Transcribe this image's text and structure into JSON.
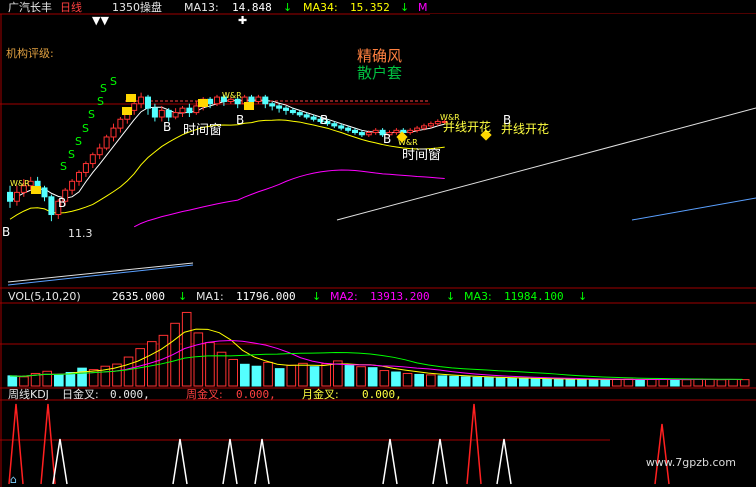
{
  "header": {
    "stock_name": "广汽长丰",
    "period": "日线",
    "indicator": "1350操盘",
    "ma13_label": "MA13:",
    "ma13_value": "14.848",
    "ma34_label": "MA34:",
    "ma34_value": "15.352",
    "arrow": "↓",
    "cut_mark": "M"
  },
  "price_panel": {
    "rating_label": "机构评级:",
    "overlay_line1": "精确风",
    "overlay_line2": "散户套",
    "low_label": "11.3",
    "time_window_label": "时间窗",
    "merge_label": "并线开花",
    "buy_mark": "B",
    "sell_mark": "S",
    "war_mark": "W&R"
  },
  "vol_header": {
    "name": "VOL(5,10,20)",
    "value": "2635.000",
    "ma1_label": "MA1:",
    "ma1_value": "11796.000",
    "ma2_label": "MA2:",
    "ma2_value": "13913.200",
    "ma3_label": "MA3:",
    "ma3_value": "11984.100",
    "arrow": "↓"
  },
  "kdj_header": {
    "name": "周线KDJ",
    "daily_label": "日金叉:",
    "daily_value": "0.000,",
    "weekly_label": "周金叉:",
    "weekly_value": "0.000,",
    "monthly_label": "月金叉:",
    "monthly_value": "0.000,"
  },
  "watermark": "www.7gpzb.com",
  "colors": {
    "up": "#ff3232",
    "down": "#54ffff",
    "ma_white": "#ffffff",
    "ma_yellow": "#ffff00",
    "ma_magenta": "#ff00ff",
    "ma_blue": "#5aa0ff",
    "grid": "#a00000"
  },
  "chart_data": [
    {
      "type": "candlestick",
      "series": [
        {
          "name": "MA13",
          "value": 14.848
        },
        {
          "name": "MA34",
          "value": 15.352
        }
      ],
      "low_annotation": 11.3,
      "candles": [
        {
          "o": 12.6,
          "c": 12.2,
          "h": 12.9,
          "l": 11.9
        },
        {
          "o": 12.2,
          "c": 12.6,
          "h": 12.9,
          "l": 12.0
        },
        {
          "o": 12.6,
          "c": 12.9,
          "h": 13.2,
          "l": 12.4
        },
        {
          "o": 12.9,
          "c": 13.1,
          "h": 13.3,
          "l": 12.7
        },
        {
          "o": 13.1,
          "c": 12.8,
          "h": 13.3,
          "l": 12.6
        },
        {
          "o": 12.8,
          "c": 12.4,
          "h": 12.9,
          "l": 12.2
        },
        {
          "o": 12.4,
          "c": 11.6,
          "h": 12.5,
          "l": 11.3
        },
        {
          "o": 11.6,
          "c": 12.2,
          "h": 12.3,
          "l": 11.4
        },
        {
          "o": 12.2,
          "c": 12.7,
          "h": 12.8,
          "l": 12.0
        },
        {
          "o": 12.7,
          "c": 13.1,
          "h": 13.2,
          "l": 12.5
        },
        {
          "o": 13.1,
          "c": 13.5,
          "h": 13.6,
          "l": 12.9
        },
        {
          "o": 13.5,
          "c": 13.9,
          "h": 14.0,
          "l": 13.3
        },
        {
          "o": 13.9,
          "c": 14.3,
          "h": 14.4,
          "l": 13.7
        },
        {
          "o": 14.3,
          "c": 14.6,
          "h": 14.8,
          "l": 14.1
        },
        {
          "o": 14.6,
          "c": 15.1,
          "h": 15.2,
          "l": 14.5
        },
        {
          "o": 15.1,
          "c": 15.5,
          "h": 15.7,
          "l": 14.9
        },
        {
          "o": 15.5,
          "c": 15.9,
          "h": 16.0,
          "l": 15.3
        },
        {
          "o": 15.9,
          "c": 16.3,
          "h": 16.4,
          "l": 15.7
        },
        {
          "o": 16.3,
          "c": 16.6,
          "h": 16.8,
          "l": 16.1
        },
        {
          "o": 16.6,
          "c": 16.9,
          "h": 17.1,
          "l": 16.4
        },
        {
          "o": 16.9,
          "c": 16.4,
          "h": 17.0,
          "l": 16.1
        },
        {
          "o": 16.4,
          "c": 16.0,
          "h": 16.6,
          "l": 15.8
        },
        {
          "o": 16.0,
          "c": 16.3,
          "h": 16.5,
          "l": 15.8
        },
        {
          "o": 16.3,
          "c": 16.0,
          "h": 16.4,
          "l": 15.8
        },
        {
          "o": 16.0,
          "c": 16.2,
          "h": 16.4,
          "l": 15.9
        },
        {
          "o": 16.2,
          "c": 16.4,
          "h": 16.5,
          "l": 16.0
        },
        {
          "o": 16.4,
          "c": 16.2,
          "h": 16.6,
          "l": 16.0
        },
        {
          "o": 16.2,
          "c": 16.5,
          "h": 16.7,
          "l": 16.1
        },
        {
          "o": 16.5,
          "c": 16.8,
          "h": 16.9,
          "l": 16.3
        },
        {
          "o": 16.8,
          "c": 16.6,
          "h": 16.9,
          "l": 16.4
        },
        {
          "o": 16.6,
          "c": 16.9,
          "h": 17.0,
          "l": 16.5
        },
        {
          "o": 16.9,
          "c": 16.7,
          "h": 17.0,
          "l": 16.5
        },
        {
          "o": 16.7,
          "c": 16.8,
          "h": 16.9,
          "l": 16.6
        },
        {
          "o": 16.8,
          "c": 16.6,
          "h": 16.9,
          "l": 16.4
        },
        {
          "o": 16.6,
          "c": 16.9,
          "h": 17.0,
          "l": 16.5
        },
        {
          "o": 16.9,
          "c": 16.7,
          "h": 17.0,
          "l": 16.6
        },
        {
          "o": 16.7,
          "c": 16.9,
          "h": 17.0,
          "l": 16.6
        },
        {
          "o": 16.9,
          "c": 16.6,
          "h": 17.0,
          "l": 16.4
        },
        {
          "o": 16.6,
          "c": 16.5,
          "h": 16.7,
          "l": 16.3
        },
        {
          "o": 16.5,
          "c": 16.4,
          "h": 16.6,
          "l": 16.2
        },
        {
          "o": 16.4,
          "c": 16.3,
          "h": 16.5,
          "l": 16.1
        },
        {
          "o": 16.3,
          "c": 16.2,
          "h": 16.4,
          "l": 16.1
        },
        {
          "o": 16.2,
          "c": 16.1,
          "h": 16.3,
          "l": 16.0
        },
        {
          "o": 16.1,
          "c": 16.0,
          "h": 16.2,
          "l": 15.9
        },
        {
          "o": 16.0,
          "c": 15.9,
          "h": 16.1,
          "l": 15.8
        },
        {
          "o": 15.9,
          "c": 15.8,
          "h": 16.0,
          "l": 15.7
        },
        {
          "o": 15.8,
          "c": 15.7,
          "h": 15.9,
          "l": 15.6
        },
        {
          "o": 15.7,
          "c": 15.6,
          "h": 15.8,
          "l": 15.5
        },
        {
          "o": 15.6,
          "c": 15.5,
          "h": 15.7,
          "l": 15.4
        },
        {
          "o": 15.5,
          "c": 15.4,
          "h": 15.6,
          "l": 15.3
        },
        {
          "o": 15.4,
          "c": 15.3,
          "h": 15.5,
          "l": 15.2
        },
        {
          "o": 15.3,
          "c": 15.2,
          "h": 15.4,
          "l": 15.1
        },
        {
          "o": 15.2,
          "c": 15.3,
          "h": 15.4,
          "l": 15.1
        },
        {
          "o": 15.3,
          "c": 15.4,
          "h": 15.5,
          "l": 15.2
        },
        {
          "o": 15.4,
          "c": 15.2,
          "h": 15.5,
          "l": 15.1
        },
        {
          "o": 15.2,
          "c": 15.3,
          "h": 15.4,
          "l": 15.1
        },
        {
          "o": 15.3,
          "c": 15.4,
          "h": 15.5,
          "l": 15.2
        },
        {
          "o": 15.4,
          "c": 15.3,
          "h": 15.5,
          "l": 15.2
        },
        {
          "o": 15.3,
          "c": 15.4,
          "h": 15.5,
          "l": 15.2
        },
        {
          "o": 15.4,
          "c": 15.5,
          "h": 15.6,
          "l": 15.3
        },
        {
          "o": 15.5,
          "c": 15.6,
          "h": 15.7,
          "l": 15.4
        },
        {
          "o": 15.6,
          "c": 15.7,
          "h": 15.8,
          "l": 15.5
        },
        {
          "o": 15.7,
          "c": 15.8,
          "h": 15.9,
          "l": 15.6
        },
        {
          "o": 15.8,
          "c": 15.8,
          "h": 15.9,
          "l": 15.7
        }
      ]
    },
    {
      "type": "bar",
      "series": [
        {
          "name": "MA1",
          "value": 11796.0
        },
        {
          "name": "MA2",
          "value": 13913.2
        },
        {
          "name": "MA3",
          "value": 11984.1
        }
      ],
      "last_value": 2635.0,
      "values": [
        4200,
        3800,
        5200,
        6100,
        4800,
        5600,
        7400,
        6800,
        8200,
        9100,
        12000,
        15500,
        18400,
        21000,
        26000,
        30500,
        22000,
        18000,
        14000,
        11000,
        9000,
        8200,
        9800,
        7200,
        8600,
        9400,
        8000,
        9200,
        10400,
        8800,
        8000,
        7600,
        6400,
        5800,
        5200,
        4800,
        4600,
        4200,
        4000,
        3800,
        3600,
        3500,
        3300,
        3200,
        3100,
        3000,
        2900,
        2800,
        2800,
        2700,
        2700,
        2600,
        2700,
        2800,
        2600,
        2700,
        2800,
        2700,
        2600,
        2800,
        2700,
        2600,
        2700,
        2635
      ],
      "ylim": [
        0,
        34000
      ]
    },
    {
      "type": "line",
      "series": [
        {
          "name": "日金叉",
          "value": 0.0
        },
        {
          "name": "周金叉",
          "value": 0.0
        },
        {
          "name": "月金叉",
          "value": 0.0
        }
      ]
    }
  ]
}
